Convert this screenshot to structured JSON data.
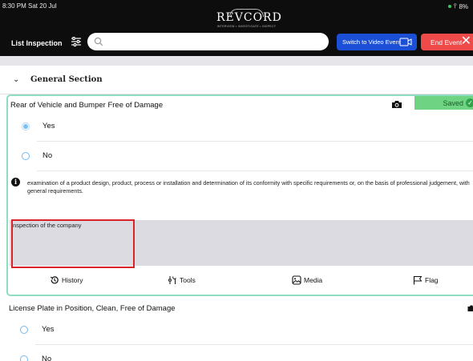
{
  "status_bar": {
    "time": "8:30 PM  Sat 20 Jul",
    "battery": "8%"
  },
  "header": {
    "logo_text": "REVCORD",
    "logo_subtitle": "INTERVIEW • INVESTIGATE • INSPECT",
    "title": "List Inspection",
    "search_placeholder": "",
    "video_button_label": "Switch to Video Event",
    "end_button_label": "End Event"
  },
  "section": {
    "title": "General Section"
  },
  "question1": {
    "title": "Rear of Vehicle and Bumper Free of Damage",
    "saved_label": "Saved",
    "options": [
      {
        "label": "Yes",
        "selected": true
      },
      {
        "label": "No",
        "selected": false
      }
    ],
    "info_text": "examination of a product design, product, process or installation and determination of its conformity with specific requirements or, on the basis of professional judgement, with general requirements.",
    "notes_value": "Inspection of the company",
    "toolbar": {
      "history": "History",
      "tools": "Tools",
      "media": "Media",
      "flag": "Flag"
    }
  },
  "question2": {
    "title": "License Plate in Position, Clean, Free of Damage",
    "options": [
      {
        "label": "Yes",
        "selected": false
      },
      {
        "label": "No",
        "selected": false
      }
    ]
  },
  "colors": {
    "header_bg": "#0d0d0d",
    "video_button": "#1a4fd6",
    "end_button": "#ef4a4a",
    "saved_badge": "#6ed483",
    "card_border": "#8fdcc4",
    "radio": "#7cc0f2",
    "highlight": "#d8232a"
  }
}
